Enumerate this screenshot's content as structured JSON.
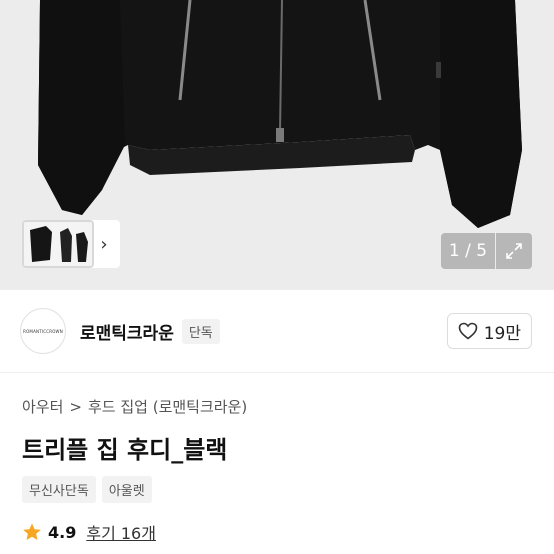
{
  "gallery": {
    "page_indicator": "1 / 5",
    "expand_icon": "expand-arrows-icon",
    "next_icon": "chevron-right-icon"
  },
  "brand": {
    "logo_text": "ROMANTICCROWN",
    "name": "로맨틱크라운",
    "badge": "단독",
    "like_count": "19만",
    "like_icon": "heart-outline-icon"
  },
  "breadcrumb": {
    "level1": "아우터",
    "separator": ">",
    "level2": "후드 집업 (로맨틱크라운)"
  },
  "product": {
    "title": "트리플 집 후디_블랙",
    "tags": [
      "무신사단독",
      "아울렛"
    ]
  },
  "rating": {
    "icon": "star-icon",
    "icon_color": "#f5a623",
    "value": "4.9",
    "reviews_label": "후기 16개"
  }
}
